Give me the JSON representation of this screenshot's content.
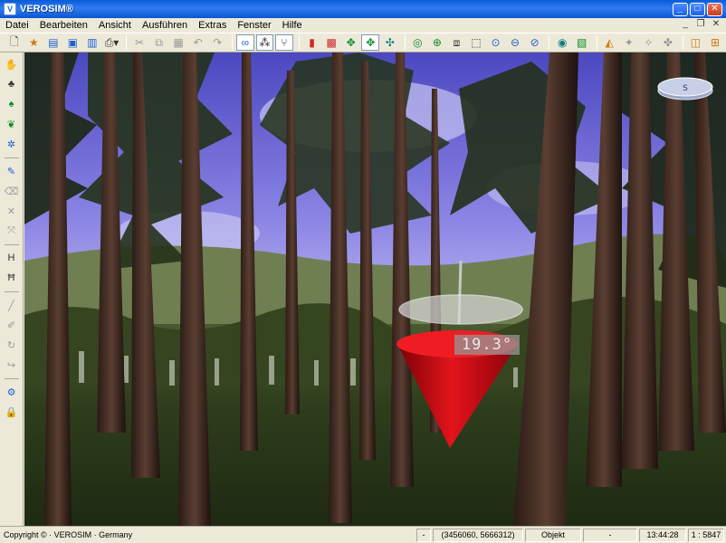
{
  "window": {
    "title": "VEROSIM®",
    "icon": "app-logo-icon"
  },
  "menu": [
    "Datei",
    "Bearbeiten",
    "Ansicht",
    "Ausführen",
    "Extras",
    "Fenster",
    "Hilfe"
  ],
  "viewport": {
    "angle_readout": "19.3°"
  },
  "status": {
    "copyright": "Copyright © · VEROSIM · Germany",
    "field1": "-",
    "coords": "(3456060, 5666312)",
    "mode": "Objekt",
    "field2": "-",
    "time": "13:44:28",
    "scale": "1 : 5847"
  },
  "colors": {
    "titlebar": "#0a5bd8",
    "chrome": "#ece9d8",
    "cone": "#d8141c",
    "sky": "#8c86e6"
  }
}
